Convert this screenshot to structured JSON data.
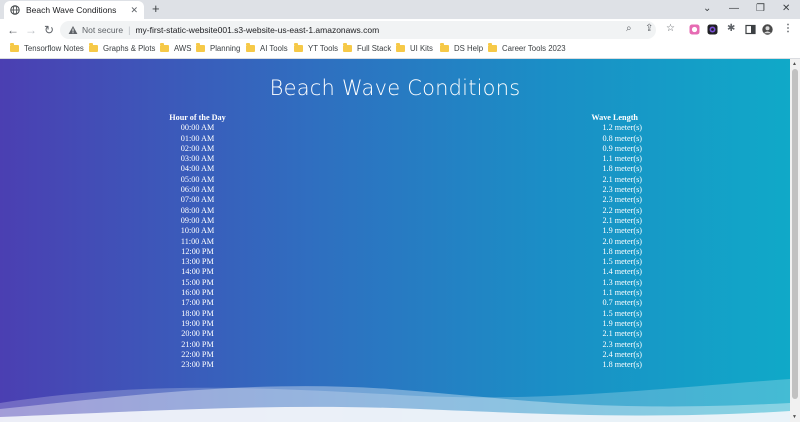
{
  "browser": {
    "tab_title": "Beach Wave Conditions",
    "tab_close": "✕",
    "new_tab": "+",
    "security_label": "Not secure",
    "url": "my-first-static-website001.s3-website-us-east-1.amazonaws.com"
  },
  "bookmarks": [
    {
      "label": "Tensorflow Notes"
    },
    {
      "label": "Graphs & Plots"
    },
    {
      "label": "AWS"
    },
    {
      "label": "Planning"
    },
    {
      "label": "AI Tools"
    },
    {
      "label": "YT Tools"
    },
    {
      "label": "Full Stack"
    },
    {
      "label": "UI Kits"
    },
    {
      "label": "DS Help"
    },
    {
      "label": "Career Tools 2023"
    }
  ],
  "page": {
    "title": "Beach Wave Conditions",
    "table": {
      "headers": [
        "Hour of the Day",
        "Wave Length"
      ],
      "rows": [
        [
          "00:00 AM",
          "1.2 meter(s)"
        ],
        [
          "01:00 AM",
          "0.8 meter(s)"
        ],
        [
          "02:00 AM",
          "0.9 meter(s)"
        ],
        [
          "03:00 AM",
          "1.1 meter(s)"
        ],
        [
          "04:00 AM",
          "1.8 meter(s)"
        ],
        [
          "05:00 AM",
          "2.1 meter(s)"
        ],
        [
          "06:00 AM",
          "2.3 meter(s)"
        ],
        [
          "07:00 AM",
          "2.3 meter(s)"
        ],
        [
          "08:00 AM",
          "2.2 meter(s)"
        ],
        [
          "09:00 AM",
          "2.1 meter(s)"
        ],
        [
          "10:00 AM",
          "1.9 meter(s)"
        ],
        [
          "11:00 AM",
          "2.0 meter(s)"
        ],
        [
          "12:00 PM",
          "1.8 meter(s)"
        ],
        [
          "13:00 PM",
          "1.5 meter(s)"
        ],
        [
          "14:00 PM",
          "1.4 meter(s)"
        ],
        [
          "15:00 PM",
          "1.3 meter(s)"
        ],
        [
          "16:00 PM",
          "1.1 meter(s)"
        ],
        [
          "17:00 PM",
          "0.7 meter(s)"
        ],
        [
          "18:00 PM",
          "1.5 meter(s)"
        ],
        [
          "19:00 PM",
          "1.9 meter(s)"
        ],
        [
          "20:00 PM",
          "2.1 meter(s)"
        ],
        [
          "21:00 PM",
          "2.3 meter(s)"
        ],
        [
          "22:00 PM",
          "2.4 meter(s)"
        ],
        [
          "23:00 PM",
          "1.8 meter(s)"
        ]
      ]
    }
  },
  "colors": {
    "gradient_left": "#4b3fb2",
    "gradient_right": "#10a9c8",
    "bookmark_folder": "#f6c948"
  },
  "icons": {
    "tab_favicon": "globe-icon",
    "security": "warning-triangle-icon",
    "back": "arrow-left-icon",
    "forward": "arrow-right-icon",
    "reload": "reload-icon",
    "zoom": "magnifier-icon",
    "share": "share-icon",
    "bookmark": "star-icon",
    "extensions": "puzzle-icon",
    "side_panel": "side-panel-icon",
    "profile": "avatar-icon",
    "menu": "kebab-menu-icon"
  }
}
